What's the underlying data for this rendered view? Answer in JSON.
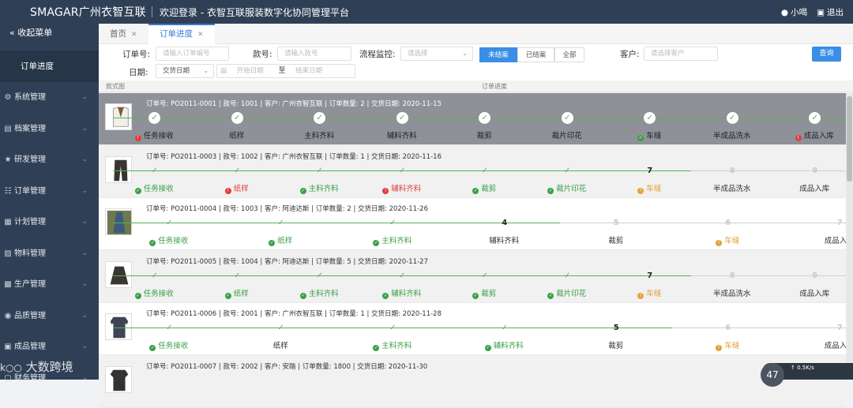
{
  "header": {
    "logo": "SMAGAR广州衣智互联",
    "subtitle": "欢迎登录 - 衣智互联服装数字化协同管理平台",
    "user": "小喝",
    "logout": "退出"
  },
  "sidebar": {
    "collapse": "收起菜单",
    "active_sub": "订单进度",
    "items": [
      {
        "label": "系统管理",
        "icon": "gear-icon"
      },
      {
        "label": "档案管理",
        "icon": "folder-icon"
      },
      {
        "label": "研发管理",
        "icon": "star-icon"
      },
      {
        "label": "订单管理",
        "icon": "doc-icon"
      },
      {
        "label": "计划管理",
        "icon": "calendar-icon"
      },
      {
        "label": "物料管理",
        "icon": "box-icon"
      },
      {
        "label": "生产管理",
        "icon": "factory-icon"
      },
      {
        "label": "品质管理",
        "icon": "shield-icon"
      },
      {
        "label": "成品管理",
        "icon": "cube-icon"
      },
      {
        "label": "财务管理",
        "icon": "money-icon"
      }
    ]
  },
  "tabs": [
    {
      "label": "首页"
    },
    {
      "label": "订单进度"
    }
  ],
  "filters": {
    "order_no_label": "订单号:",
    "order_no_ph": "请输入订单编号",
    "style_no_label": "款号:",
    "style_no_ph": "请输入款号",
    "flow_label": "流程监控:",
    "flow_ph": "请选择",
    "seg": [
      "未结案",
      "已结案",
      "全部"
    ],
    "customer_label": "客户:",
    "customer_ph": "请选择客户",
    "query": "查询",
    "date_label": "日期:",
    "date_type": "交货日期",
    "start_ph": "开始日期",
    "to": "至",
    "end_ph": "结束日期"
  },
  "table": {
    "col_image": "款式图",
    "col_progress": "订单进度"
  },
  "step_names": [
    "任务接收",
    "纸样",
    "主料齐料",
    "辅料齐料",
    "裁剪",
    "裁片印花",
    "车缝",
    "半成品洗水",
    "成品入库"
  ],
  "orders": [
    {
      "info": "订单号: PO2011-0001 | 款号: 1001 | 客户: 广州衣智互联 | 订单数量: 2 | 交货日期: 2020-11-15",
      "img": "vest",
      "steps": [
        [
          "done",
          "",
          "err"
        ],
        [
          "done",
          "",
          ""
        ],
        [
          "done",
          "",
          ""
        ],
        [
          "done",
          "",
          ""
        ],
        [
          "done",
          "",
          ""
        ],
        [
          "done",
          "",
          ""
        ],
        [
          "done",
          "",
          "ok"
        ],
        [
          "done",
          "",
          ""
        ],
        [
          "done",
          "",
          "err"
        ]
      ]
    },
    {
      "info": "订单号: PO2011-0003 | 款号: 1002 | 客户: 广州衣智互联 | 订单数量: 1 | 交货日期: 2020-11-16",
      "img": "pants",
      "steps": [
        [
          "done",
          "",
          "ok"
        ],
        [
          "done",
          "",
          "err"
        ],
        [
          "done",
          "",
          "ok"
        ],
        [
          "done",
          "",
          "err"
        ],
        [
          "done",
          "",
          "ok"
        ],
        [
          "done",
          "",
          "ok"
        ],
        [
          "cur",
          "7",
          "warn"
        ],
        [
          "todo",
          "8",
          ""
        ],
        [
          "todo",
          "9",
          ""
        ]
      ]
    },
    {
      "info": "订单号: PO2011-0004 | 款号: 1003 | 客户: 阿迪达斯 | 订单数量: 2 | 交货日期: 2020-11-26",
      "img": "dress",
      "steps": [
        [
          "done",
          "",
          "ok"
        ],
        [
          "done",
          "",
          "ok"
        ],
        [
          "done",
          "",
          "ok"
        ],
        [
          "cur",
          "4",
          ""
        ],
        [
          "todo",
          "5",
          ""
        ],
        [
          "todo",
          "6",
          "warn"
        ],
        [
          "todo",
          "7",
          ""
        ]
      ],
      "names": [
        "任务接收",
        "纸样",
        "主料齐料",
        "辅料齐料",
        "裁剪",
        "车缝",
        "成品入库"
      ]
    },
    {
      "info": "订单号: PO2011-0005 | 款号: 1004 | 客户: 阿迪达斯 | 订单数量: 5 | 交货日期: 2020-11-27",
      "img": "skirt",
      "steps": [
        [
          "done",
          "",
          "ok"
        ],
        [
          "done",
          "",
          "ok"
        ],
        [
          "done",
          "",
          "ok"
        ],
        [
          "done",
          "",
          "ok"
        ],
        [
          "done",
          "",
          "ok"
        ],
        [
          "done",
          "",
          "ok"
        ],
        [
          "cur",
          "7",
          "warn"
        ],
        [
          "todo",
          "8",
          ""
        ],
        [
          "todo",
          "9",
          ""
        ]
      ]
    },
    {
      "info": "订单号: PO2011-0006 | 款号: 2001 | 客户: 广州衣智互联 | 订单数量: 1 | 交货日期: 2020-11-28",
      "img": "shirt",
      "steps": [
        [
          "done",
          "",
          "ok"
        ],
        [
          "done",
          "",
          ""
        ],
        [
          "done",
          "",
          "ok"
        ],
        [
          "done",
          "",
          "ok"
        ],
        [
          "cur",
          "5",
          ""
        ],
        [
          "todo",
          "6",
          "warn"
        ],
        [
          "todo",
          "7",
          ""
        ]
      ],
      "names": [
        "任务接收",
        "纸样",
        "主料齐料",
        "辅料齐料",
        "裁剪",
        "车缝",
        "成品入库"
      ]
    },
    {
      "info": "订单号: PO2011-0007 | 款号: 2002 | 客户: 安踏 | 订单数量: 1800 | 交货日期: 2020-11-30",
      "img": "shirt2",
      "steps": []
    }
  ],
  "watermark": "大数跨境",
  "speed": {
    "percent": "47",
    "rate": "0.5K/s"
  }
}
